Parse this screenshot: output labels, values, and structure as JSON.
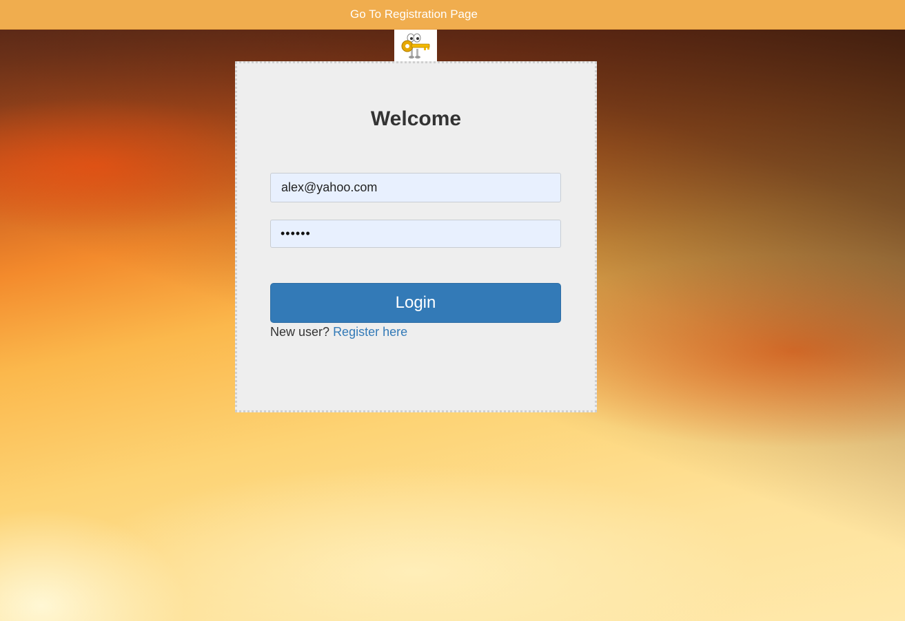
{
  "topbar": {
    "link_label": "Go To Registration Page",
    "background": "#f0ad4e"
  },
  "logo": {
    "icon": "key-character-icon"
  },
  "login_card": {
    "title": "Welcome",
    "email_value": "alex@yahoo.com",
    "password_masked": "••••••",
    "login_label": "Login",
    "new_user_text": "New user?",
    "register_link_label": "Register here"
  },
  "colors": {
    "primary_button": "#337ab7",
    "link": "#337ab7",
    "card_background": "#eeeeee",
    "input_background": "#e8f0fe"
  }
}
